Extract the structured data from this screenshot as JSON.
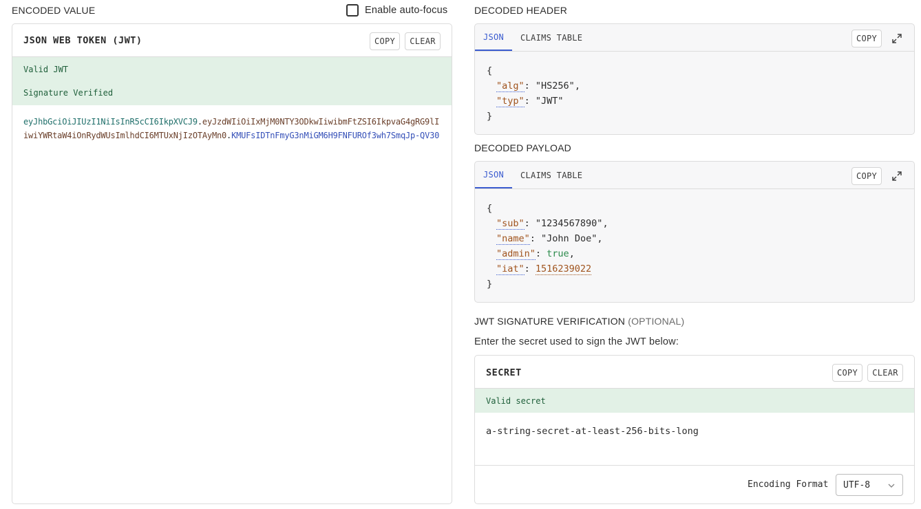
{
  "encoded": {
    "section_title": "ENCODED VALUE",
    "autofocus_label": "Enable auto-focus",
    "autofocus_checked": false,
    "panel_title": "JSON WEB TOKEN (JWT)",
    "copy_label": "COPY",
    "clear_label": "CLEAR",
    "status_valid": "Valid JWT",
    "status_signature": "Signature Verified",
    "token_line1_header": "eyJhbGciOiJIUzI1NiIsInR5cCI6IkpXVCJ9",
    "token_line1_dot": ".",
    "token_line1_payload": "eyJzdWIiOiIxMjM0NTY3ODkwIiwibmFtZSI6IkpvaG4gRG9lI",
    "token_line2_payload": "iwiYWRtaW4iOnRydWUsImlhdCI6MTUxNjIzOTAyMn0",
    "token_line2_dot": ".",
    "token_line2_sig": "KMUFsIDTnFmyG3nMiGM6H9FNFUROf3wh7SmqJp-QV30"
  },
  "decoded_header": {
    "section_title": "DECODED HEADER",
    "tab_json": "JSON",
    "tab_claims": "CLAIMS TABLE",
    "copy_label": "COPY",
    "open_brace": "{",
    "close_brace": "}",
    "fields": [
      {
        "key": "\"alg\"",
        "value": "\"HS256\"",
        "comma": ","
      },
      {
        "key": "\"typ\"",
        "value": "\"JWT\"",
        "comma": ""
      }
    ]
  },
  "decoded_payload": {
    "section_title": "DECODED PAYLOAD",
    "tab_json": "JSON",
    "tab_claims": "CLAIMS TABLE",
    "copy_label": "COPY",
    "open_brace": "{",
    "close_brace": "}",
    "fields": [
      {
        "key": "\"sub\"",
        "value": "\"1234567890\"",
        "comma": ","
      },
      {
        "key": "\"name\"",
        "value": "\"John Doe\"",
        "comma": ","
      },
      {
        "key": "\"admin\"",
        "value": "true",
        "comma": ","
      },
      {
        "key": "\"iat\"",
        "value": "1516239022",
        "comma": ""
      }
    ]
  },
  "verification": {
    "section_title": "JWT SIGNATURE VERIFICATION",
    "optional": "(OPTIONAL)",
    "instruction": "Enter the secret used to sign the JWT below:",
    "panel_title": "SECRET",
    "copy_label": "COPY",
    "clear_label": "CLEAR",
    "status": "Valid secret",
    "secret_value": "a-string-secret-at-least-256-bits-long",
    "encoding_label": "Encoding Format",
    "encoding_value": "UTF-8"
  },
  "colors": {
    "accent": "#3a5bcf",
    "valid_bg": "#e2f1e6",
    "valid_text": "#1f5f3a"
  }
}
